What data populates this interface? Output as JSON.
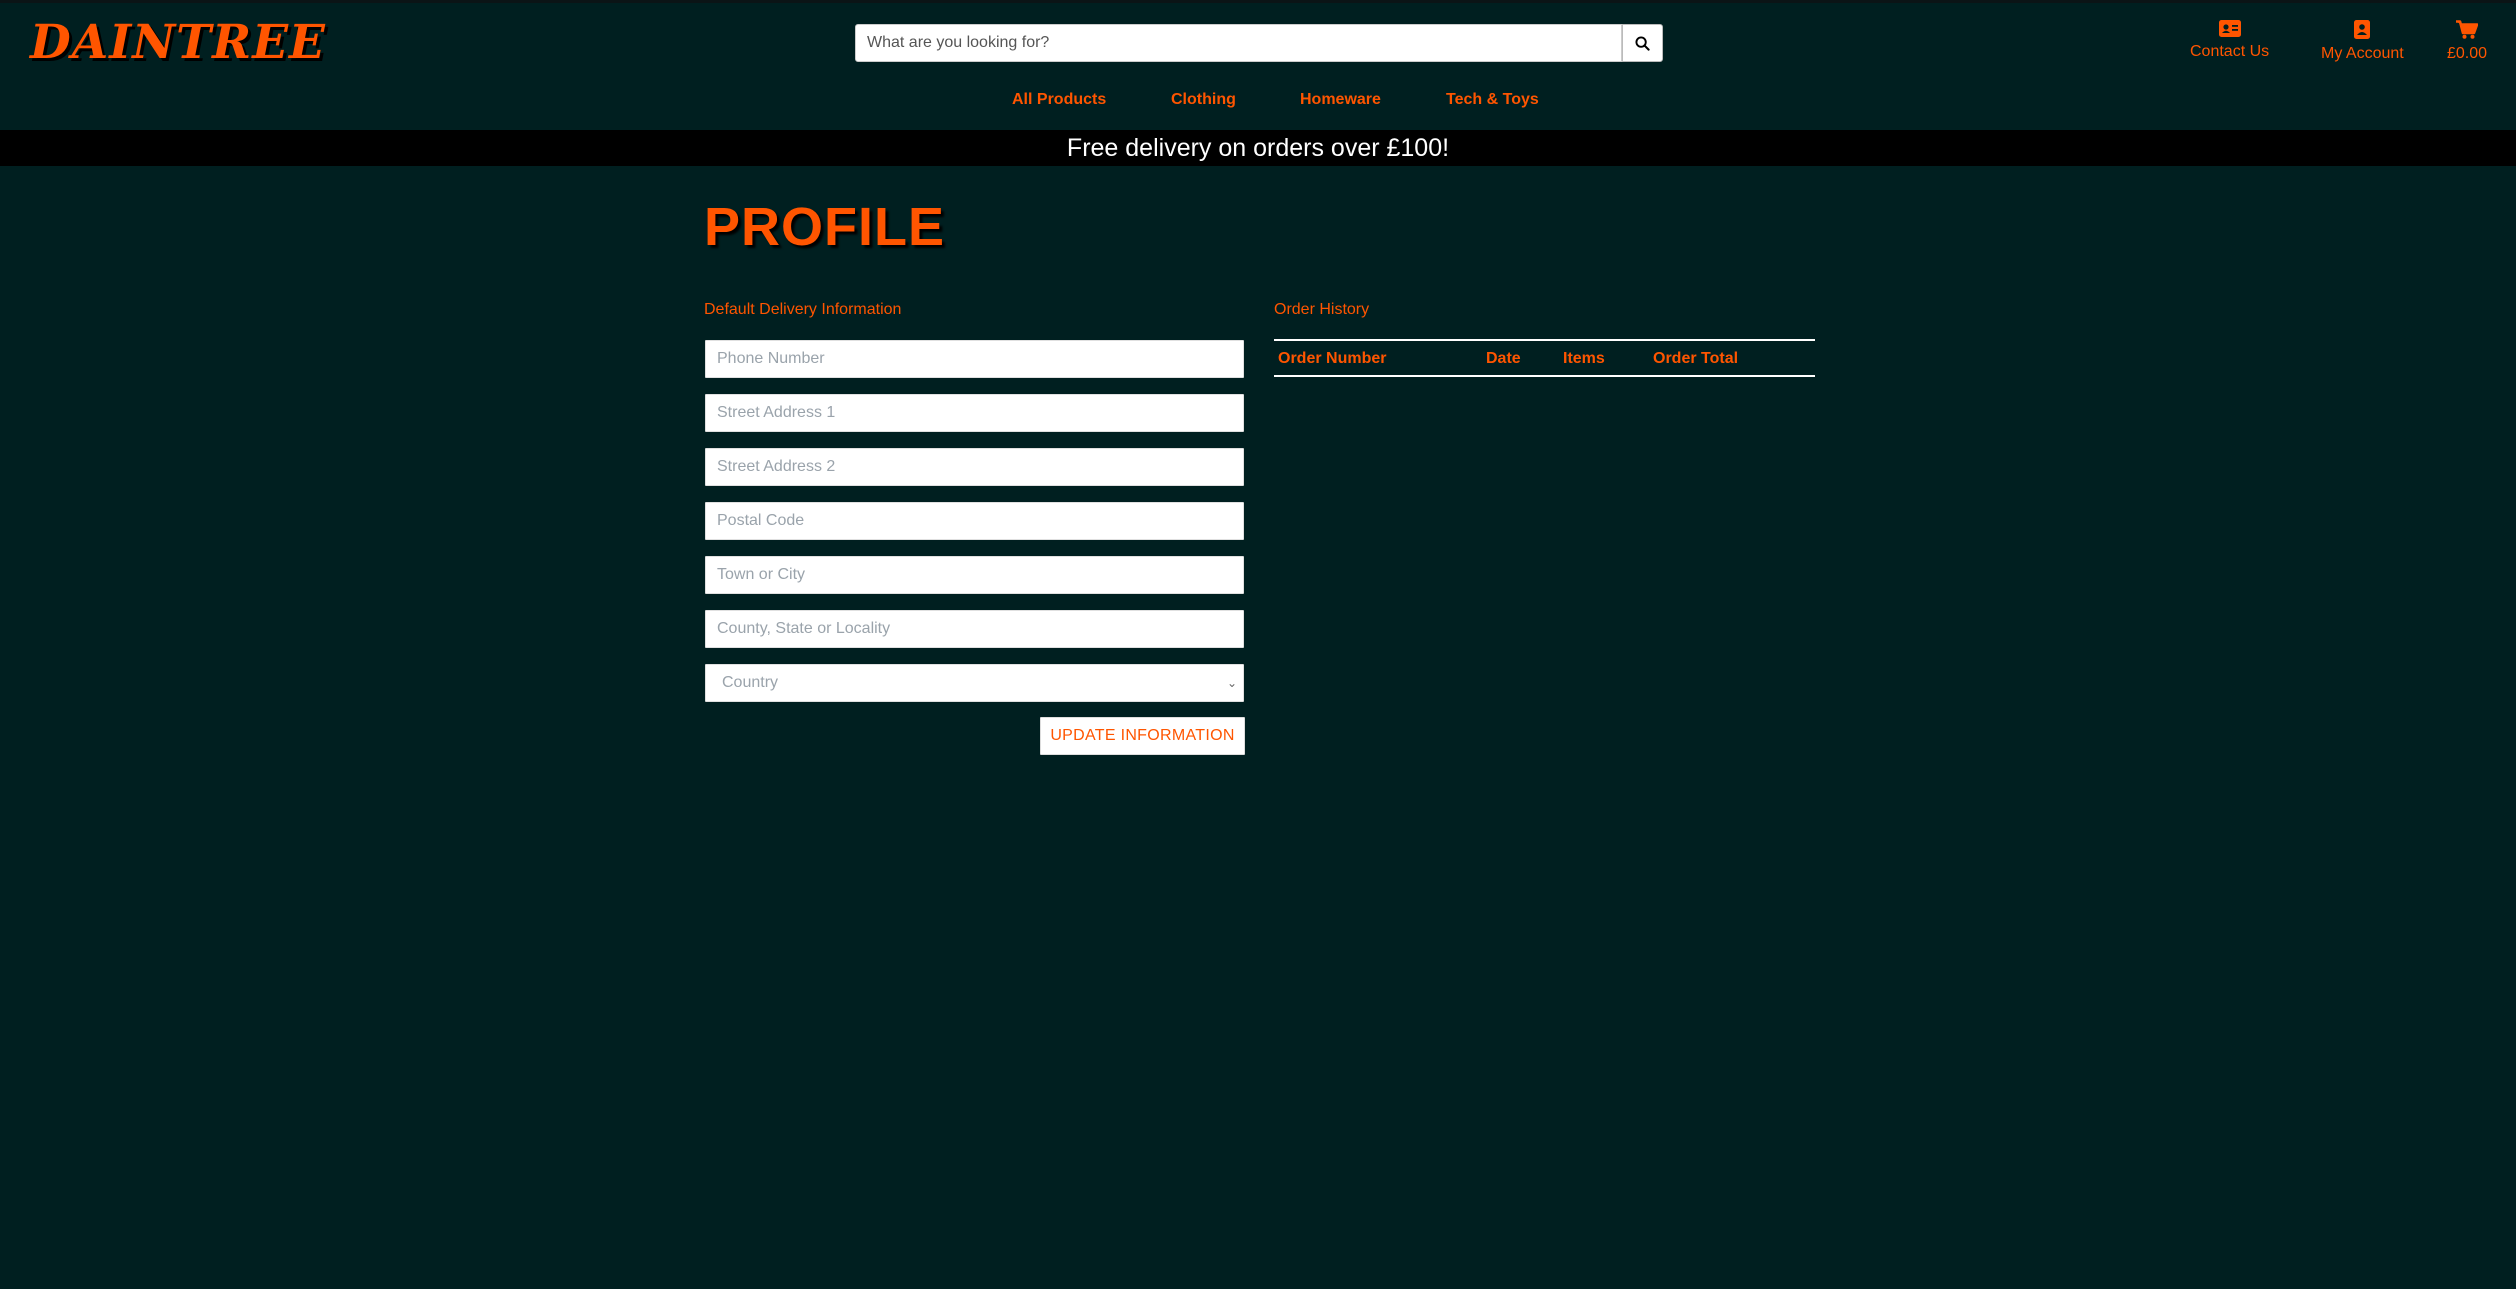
{
  "header": {
    "logo_text": "DAINTREE",
    "search": {
      "placeholder": "What are you looking for?",
      "icon": "search-icon"
    },
    "links": {
      "contact": {
        "label": "Contact Us",
        "icon": "contact-card-icon"
      },
      "account": {
        "label": "My Account",
        "icon": "user-icon"
      },
      "basket": {
        "label": "£0.00",
        "icon": "cart-icon"
      }
    }
  },
  "nav": {
    "items": [
      {
        "label": "All Products"
      },
      {
        "label": "Clothing"
      },
      {
        "label": "Homeware"
      },
      {
        "label": "Tech & Toys"
      }
    ]
  },
  "banner": {
    "text": "Free delivery on orders over £100!"
  },
  "profile": {
    "title": "PROFILE",
    "delivery": {
      "heading": "Default Delivery Information",
      "fields": {
        "phone": {
          "placeholder": "Phone Number",
          "value": ""
        },
        "street1": {
          "placeholder": "Street Address 1",
          "value": ""
        },
        "street2": {
          "placeholder": "Street Address 2",
          "value": ""
        },
        "postcode": {
          "placeholder": "Postal Code",
          "value": ""
        },
        "town": {
          "placeholder": "Town or City",
          "value": ""
        },
        "county": {
          "placeholder": "County, State or Locality",
          "value": ""
        }
      },
      "country": {
        "selected": "Country"
      },
      "submit_label": "UPDATE INFORMATION"
    },
    "orders": {
      "heading": "Order History",
      "columns": [
        "Order Number",
        "Date",
        "Items",
        "Order Total"
      ],
      "rows": []
    }
  },
  "colors": {
    "background": "#001f20",
    "accent": "#ff5500",
    "banner": "#000000"
  }
}
